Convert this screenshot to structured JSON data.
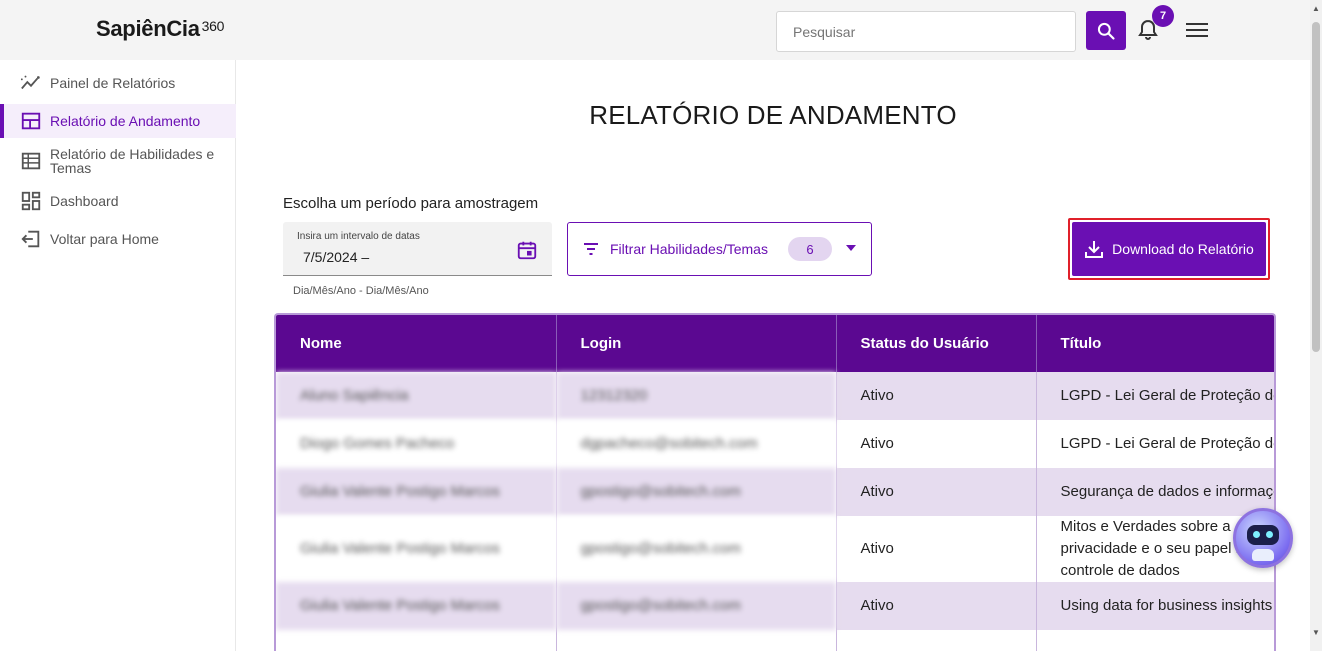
{
  "header": {
    "logo_text": "SapiênCia",
    "logo_suffix": "360",
    "search_placeholder": "Pesquisar",
    "notification_count": "7"
  },
  "sidebar": {
    "items": [
      {
        "label": "Painel de Relatórios",
        "icon": "trend-icon",
        "active": false
      },
      {
        "label": "Relatório de Andamento",
        "icon": "layout-icon",
        "active": true
      },
      {
        "label": "Relatório de Habilidades e Temas",
        "icon": "table-icon",
        "active": false
      },
      {
        "label": "Dashboard",
        "icon": "dashboard-icon",
        "active": false
      },
      {
        "label": "Voltar para Home",
        "icon": "exit-icon",
        "active": false
      }
    ]
  },
  "main": {
    "title": "RELATÓRIO DE ANDAMENTO",
    "period_label": "Escolha um período para amostragem",
    "date_field": {
      "float_label": "Insira um intervalo de datas",
      "value": "7/5/2024 –",
      "hint": "Dia/Mês/Ano - Dia/Mês/Ano"
    },
    "filter": {
      "label": "Filtrar Habilidades/Temas",
      "count": "6"
    },
    "download_label": "Download do Relatório"
  },
  "table": {
    "headers": [
      "Nome",
      "Login",
      "Status do Usuário",
      "Título"
    ],
    "rows": [
      {
        "nome": "Aluno Sapiência",
        "login": "12312320",
        "status": "Ativo",
        "titulo": "LGPD - Lei Geral de Proteção de Dados"
      },
      {
        "nome": "Diogo Gomes Pacheco",
        "login": "dgpacheco@sobitech.com",
        "status": "Ativo",
        "titulo": "LGPD - Lei Geral de Proteção de Dados"
      },
      {
        "nome": "Giulia Valente Postigo Marcos",
        "login": "gpostigo@sobitech.com",
        "status": "Ativo",
        "titulo": "Segurança de dados e informações"
      },
      {
        "nome": "Giulia Valente Postigo Marcos",
        "login": "gpostigo@sobitech.com",
        "status": "Ativo",
        "titulo": "Mitos e Verdades sobre a privacidade e o seu papel no controle de dados"
      },
      {
        "nome": "Giulia Valente Postigo Marcos",
        "login": "gpostigo@sobitech.com",
        "status": "Ativo",
        "titulo": "Using data for business insights"
      }
    ]
  },
  "colors": {
    "brand": "#6a0fb3",
    "header_row": "#5b0891",
    "row_alt": "#e6dcef",
    "highlight_border": "#e0202a"
  }
}
